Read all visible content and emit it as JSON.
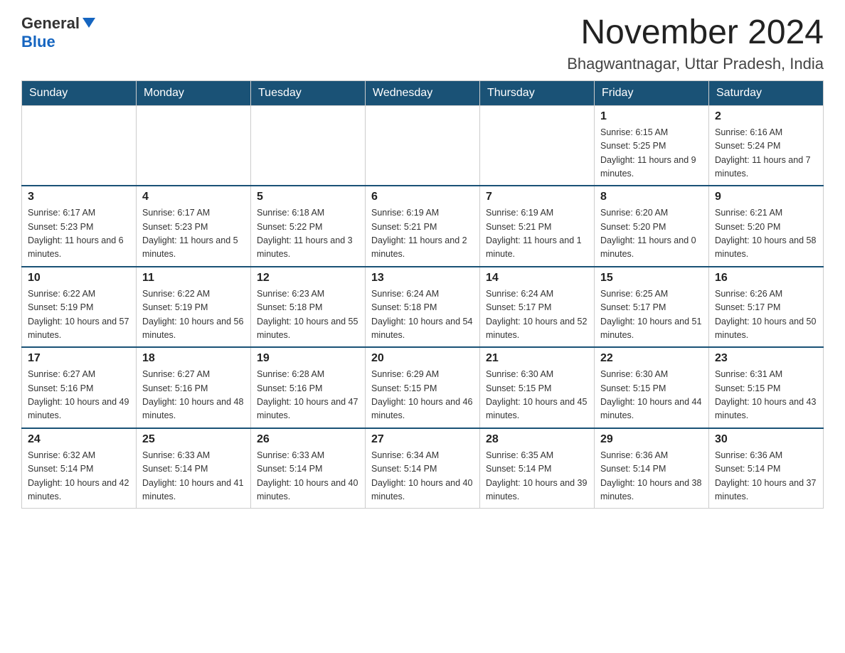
{
  "header": {
    "logo_general": "General",
    "logo_blue": "Blue",
    "month_title": "November 2024",
    "location": "Bhagwantnagar, Uttar Pradesh, India"
  },
  "weekdays": [
    "Sunday",
    "Monday",
    "Tuesday",
    "Wednesday",
    "Thursday",
    "Friday",
    "Saturday"
  ],
  "weeks": [
    [
      {
        "day": "",
        "info": ""
      },
      {
        "day": "",
        "info": ""
      },
      {
        "day": "",
        "info": ""
      },
      {
        "day": "",
        "info": ""
      },
      {
        "day": "",
        "info": ""
      },
      {
        "day": "1",
        "info": "Sunrise: 6:15 AM\nSunset: 5:25 PM\nDaylight: 11 hours and 9 minutes."
      },
      {
        "day": "2",
        "info": "Sunrise: 6:16 AM\nSunset: 5:24 PM\nDaylight: 11 hours and 7 minutes."
      }
    ],
    [
      {
        "day": "3",
        "info": "Sunrise: 6:17 AM\nSunset: 5:23 PM\nDaylight: 11 hours and 6 minutes."
      },
      {
        "day": "4",
        "info": "Sunrise: 6:17 AM\nSunset: 5:23 PM\nDaylight: 11 hours and 5 minutes."
      },
      {
        "day": "5",
        "info": "Sunrise: 6:18 AM\nSunset: 5:22 PM\nDaylight: 11 hours and 3 minutes."
      },
      {
        "day": "6",
        "info": "Sunrise: 6:19 AM\nSunset: 5:21 PM\nDaylight: 11 hours and 2 minutes."
      },
      {
        "day": "7",
        "info": "Sunrise: 6:19 AM\nSunset: 5:21 PM\nDaylight: 11 hours and 1 minute."
      },
      {
        "day": "8",
        "info": "Sunrise: 6:20 AM\nSunset: 5:20 PM\nDaylight: 11 hours and 0 minutes."
      },
      {
        "day": "9",
        "info": "Sunrise: 6:21 AM\nSunset: 5:20 PM\nDaylight: 10 hours and 58 minutes."
      }
    ],
    [
      {
        "day": "10",
        "info": "Sunrise: 6:22 AM\nSunset: 5:19 PM\nDaylight: 10 hours and 57 minutes."
      },
      {
        "day": "11",
        "info": "Sunrise: 6:22 AM\nSunset: 5:19 PM\nDaylight: 10 hours and 56 minutes."
      },
      {
        "day": "12",
        "info": "Sunrise: 6:23 AM\nSunset: 5:18 PM\nDaylight: 10 hours and 55 minutes."
      },
      {
        "day": "13",
        "info": "Sunrise: 6:24 AM\nSunset: 5:18 PM\nDaylight: 10 hours and 54 minutes."
      },
      {
        "day": "14",
        "info": "Sunrise: 6:24 AM\nSunset: 5:17 PM\nDaylight: 10 hours and 52 minutes."
      },
      {
        "day": "15",
        "info": "Sunrise: 6:25 AM\nSunset: 5:17 PM\nDaylight: 10 hours and 51 minutes."
      },
      {
        "day": "16",
        "info": "Sunrise: 6:26 AM\nSunset: 5:17 PM\nDaylight: 10 hours and 50 minutes."
      }
    ],
    [
      {
        "day": "17",
        "info": "Sunrise: 6:27 AM\nSunset: 5:16 PM\nDaylight: 10 hours and 49 minutes."
      },
      {
        "day": "18",
        "info": "Sunrise: 6:27 AM\nSunset: 5:16 PM\nDaylight: 10 hours and 48 minutes."
      },
      {
        "day": "19",
        "info": "Sunrise: 6:28 AM\nSunset: 5:16 PM\nDaylight: 10 hours and 47 minutes."
      },
      {
        "day": "20",
        "info": "Sunrise: 6:29 AM\nSunset: 5:15 PM\nDaylight: 10 hours and 46 minutes."
      },
      {
        "day": "21",
        "info": "Sunrise: 6:30 AM\nSunset: 5:15 PM\nDaylight: 10 hours and 45 minutes."
      },
      {
        "day": "22",
        "info": "Sunrise: 6:30 AM\nSunset: 5:15 PM\nDaylight: 10 hours and 44 minutes."
      },
      {
        "day": "23",
        "info": "Sunrise: 6:31 AM\nSunset: 5:15 PM\nDaylight: 10 hours and 43 minutes."
      }
    ],
    [
      {
        "day": "24",
        "info": "Sunrise: 6:32 AM\nSunset: 5:14 PM\nDaylight: 10 hours and 42 minutes."
      },
      {
        "day": "25",
        "info": "Sunrise: 6:33 AM\nSunset: 5:14 PM\nDaylight: 10 hours and 41 minutes."
      },
      {
        "day": "26",
        "info": "Sunrise: 6:33 AM\nSunset: 5:14 PM\nDaylight: 10 hours and 40 minutes."
      },
      {
        "day": "27",
        "info": "Sunrise: 6:34 AM\nSunset: 5:14 PM\nDaylight: 10 hours and 40 minutes."
      },
      {
        "day": "28",
        "info": "Sunrise: 6:35 AM\nSunset: 5:14 PM\nDaylight: 10 hours and 39 minutes."
      },
      {
        "day": "29",
        "info": "Sunrise: 6:36 AM\nSunset: 5:14 PM\nDaylight: 10 hours and 38 minutes."
      },
      {
        "day": "30",
        "info": "Sunrise: 6:36 AM\nSunset: 5:14 PM\nDaylight: 10 hours and 37 minutes."
      }
    ]
  ]
}
